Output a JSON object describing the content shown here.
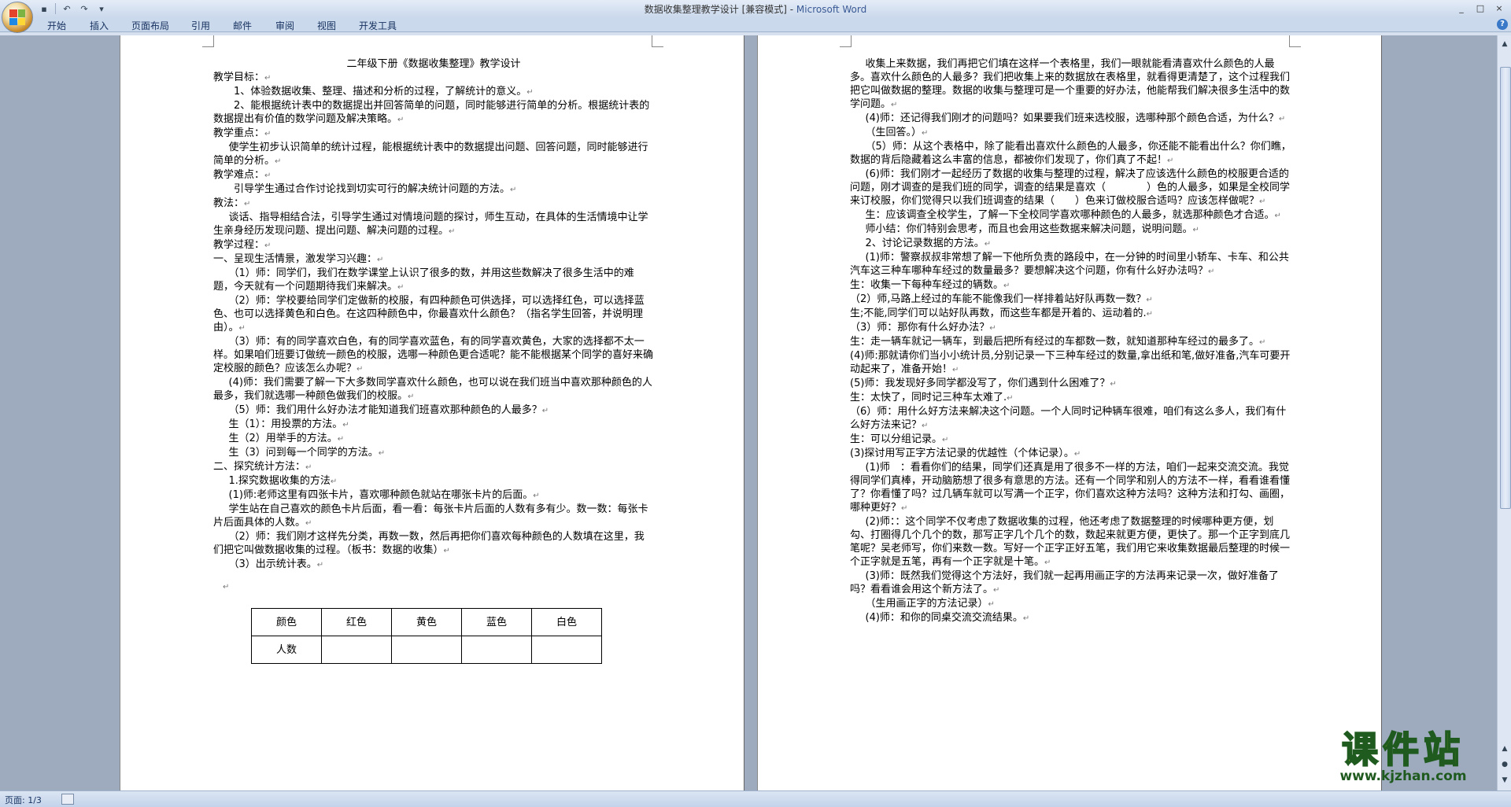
{
  "window": {
    "title_doc": "数据收集整理教学设计 [兼容模式] - ",
    "title_app": "Microsoft Word",
    "controls": [
      "_",
      "□",
      "×"
    ]
  },
  "qat": {
    "save": "▪",
    "undo": "↶",
    "redo": "↷",
    "customize": "▾"
  },
  "ribbon": {
    "tabs": [
      "开始",
      "插入",
      "页面布局",
      "引用",
      "邮件",
      "审阅",
      "视图",
      "开发工具"
    ],
    "help": "?"
  },
  "status": {
    "page": "页面: 1/3"
  },
  "watermark": {
    "brand": "课件站",
    "url": "www.kjzhan.com"
  },
  "left_page": {
    "title": "二年级下册《数据收集整理》教学设计",
    "lines": [
      {
        "t": "教学目标：",
        "c": ""
      },
      {
        "t": "1、体验数据收集、整理、描述和分析的过程，了解统计的意义。",
        "c": "ind1"
      },
      {
        "t": "2、能根据统计表中的数据提出并回答简单的问题，同时能够进行简单的分析。根据统计表的数据提出有价值的数学问题及解决策略。",
        "c": "ind1"
      },
      {
        "t": "教学重点：",
        "c": ""
      },
      {
        "t": "使学生初步认识简单的统计过程，能根据统计表中的数据提出问题、回答问题，同时能够进行简单的分析。",
        "c": "ind15"
      },
      {
        "t": "教学难点：",
        "c": ""
      },
      {
        "t": "引导学生通过合作讨论找到切实可行的解决统计问题的方法。",
        "c": "ind1"
      },
      {
        "t": "教法：",
        "c": ""
      },
      {
        "t": "谈话、指导相结合法，引导学生通过对情境问题的探讨，师生互动，在具体的生活情境中让学生亲身经历发现问题、提出问题、解决问题的过程。",
        "c": "ind15"
      },
      {
        "t": "教学过程：",
        "c": ""
      },
      {
        "t": "一、呈现生活情景，激发学习兴趣：",
        "c": ""
      },
      {
        "t": "（1）师：同学们，我们在数学课堂上认识了很多的数，并用这些数解决了很多生活中的难题，今天就有一个问题期待我们来解决。",
        "c": "ind15"
      },
      {
        "t": "（2）师：学校要给同学们定做新的校服，有四种颜色可供选择，可以选择红色，可以选择蓝色、也可以选择黄色和白色。在这四种颜色中，你最喜欢什么颜色？（指名学生回答，并说明理由）。",
        "c": "ind15"
      },
      {
        "t": "（3）师：有的同学喜欢白色，有的同学喜欢蓝色，有的同学喜欢黄色，大家的选择都不太一样。如果咱们班要订做统一颜色的校服，选哪一种颜色更合适呢？能不能根据某个同学的喜好来确定校服的颜色？应该怎么办呢？",
        "c": "ind15"
      },
      {
        "t": "(4)师：我们需要了解一下大多数同学喜欢什么颜色，也可以说在我们班当中喜欢那种颜色的人最多，我们就选哪一种颜色做我们的校服。",
        "c": "ind15"
      },
      {
        "t": "（5）师：我们用什么好办法才能知道我们班喜欢那种颜色的人最多？",
        "c": "ind15"
      },
      {
        "t": "生（1）：用投票的方法。",
        "c": "ind15"
      },
      {
        "t": "生（2）用举手的方法。",
        "c": "ind15"
      },
      {
        "t": "生（3）问到每一个同学的方法。",
        "c": "ind15"
      },
      {
        "t": "二、探究统计方法：",
        "c": ""
      },
      {
        "t": "1.探究数据收集的方法",
        "c": "ind15"
      },
      {
        "t": "(1)师:老师这里有四张卡片，喜欢哪种颜色就站在哪张卡片的后面。",
        "c": "ind15"
      },
      {
        "t": "学生站在自己喜欢的颜色卡片后面，看一看：每张卡片后面的人数有多有少。数一数：每张卡片后面具体的人数。",
        "c": "ind15"
      },
      {
        "t": "（2）师：我们刚才这样先分类，再数一数，然后再把你们喜欢每种颜色的人数填在这里，我们把它叫做数据收集的过程。（板书：数据的收集）",
        "c": "ind15"
      },
      {
        "t": "（3）出示统计表。",
        "c": "ind15"
      }
    ],
    "table": {
      "header": [
        "颜色",
        "红色",
        "黄色",
        "蓝色",
        "白色"
      ],
      "row": [
        "人数",
        "",
        "",
        "",
        ""
      ]
    }
  },
  "right_page": {
    "lines": [
      {
        "t": "收集上来数据，我们再把它们填在这样一个表格里，我们一眼就能看清喜欢什么颜色的人最多。喜欢什么颜色的人最多？我们把收集上来的数据放在表格里，就看得更清楚了，这个过程我们把它叫做数据的整理。数据的收集与整理可是一个重要的好办法，他能帮我们解决很多生活中的数学问题。",
        "c": "ind15"
      },
      {
        "t": "(4)师：还记得我们刚才的问题吗？如果要我们班来选校服，选哪种那个颜色合适，为什么？",
        "c": "ind15"
      },
      {
        "t": "（生回答。）",
        "c": "ind15"
      },
      {
        "t": "（5）师：从这个表格中，除了能看出喜欢什么颜色的人最多，你还能不能看出什么？你们瞧，数据的背后隐藏着这么丰富的信息，都被你们发现了，你们真了不起！",
        "c": "ind15"
      },
      {
        "t": "(6)师：我们刚才一起经历了数据的收集与整理的过程，解决了应该选什么颜色的校服更合适的问题，刚才调查的是我们班的同学，调查的结果是喜欢（　　　　）色的人最多，如果是全校同学来订校服，你们觉得只以我们班调查的结果（　　）色来订做校服合适吗？应该怎样做呢？",
        "c": "ind15"
      },
      {
        "t": "生：应该调查全校学生，了解一下全校同学喜欢哪种颜色的人最多，就选那种颜色才合适。",
        "c": "ind15"
      },
      {
        "t": "师小结：你们特别会思考，而且也会用这些数据来解决问题，说明问题。",
        "c": "ind15"
      },
      {
        "t": "2、讨论记录数据的方法。",
        "c": "ind15"
      },
      {
        "t": "(1)师：警察叔叔非常想了解一下他所负责的路段中，在一分钟的时间里小轿车、卡车、和公共汽车这三种车哪种车经过的数量最多？要想解决这个问题，你有什么好办法吗？",
        "c": "ind15"
      },
      {
        "t": "生：收集一下每种车经过的辆数。",
        "c": ""
      },
      {
        "t": "（2）师,马路上经过的车能不能像我们一样排着站好队再数一数？",
        "c": ""
      },
      {
        "t": "生;不能,同学们可以站好队再数，而这些车都是开着的、运动着的.",
        "c": ""
      },
      {
        "t": "（3）师：那你有什么好办法？",
        "c": ""
      },
      {
        "t": "生：走一辆车就记一辆车，到最后把所有经过的车都数一数，就知道那种车经过的最多了。",
        "c": ""
      },
      {
        "t": "(4)师:那就请你们当小小统计员,分别记录一下三种车经过的数量,拿出纸和笔,做好准备,汽车可要开动起来了，准备开始！",
        "c": ""
      },
      {
        "t": "(5)师：我发现好多同学都没写了，你们遇到什么困难了？",
        "c": ""
      },
      {
        "t": "生：太快了，同时记三种车太难了.",
        "c": ""
      },
      {
        "t": "（6）师：用什么好方法来解决这个问题。一个人同时记种辆车很难，咱们有这么多人，我们有什么好方法来记？",
        "c": ""
      },
      {
        "t": "生：可以分组记录。",
        "c": ""
      },
      {
        "t": "(3)探讨用写正字方法记录的优越性（个体记录）。",
        "c": ""
      },
      {
        "t": "(1)师　：看看你们的结果，同学们还真是用了很多不一样的方法，咱们一起来交流交流。我觉得同学们真棒，开动脑筋想了很多有意思的方法。还有一个同学和别人的方法不一样，看看谁看懂了？你看懂了吗？过几辆车就可以写满一个正字，你们喜欢这种方法吗？这种方法和打勾、画圈，哪种更好？",
        "c": "ind15"
      },
      {
        "t": "(2)师：：这个同学不仅考虑了数据收集的过程，他还考虑了数据整理的时候哪种更方便，划勾、打圈得几个几个的数，那写正字几个几个的数，数起来就更方便，更快了。那一个正字到底几笔呢？吴老师写，你们来数一数。写好一个正字正好五笔，我们用它来收集数据最后整理的时候一个正字就是五笔，再有一个正字就是十笔。",
        "c": "ind15"
      },
      {
        "t": "(3)师：既然我们觉得这个方法好，我们就一起再用画正字的方法再来记录一次，做好准备了吗？看看谁会用这个新方法了。",
        "c": "ind15"
      },
      {
        "t": "（生用画正字的方法记录）",
        "c": "ind15"
      },
      {
        "t": "(4)师：和你的同桌交流交流结果。",
        "c": "ind15"
      }
    ]
  }
}
